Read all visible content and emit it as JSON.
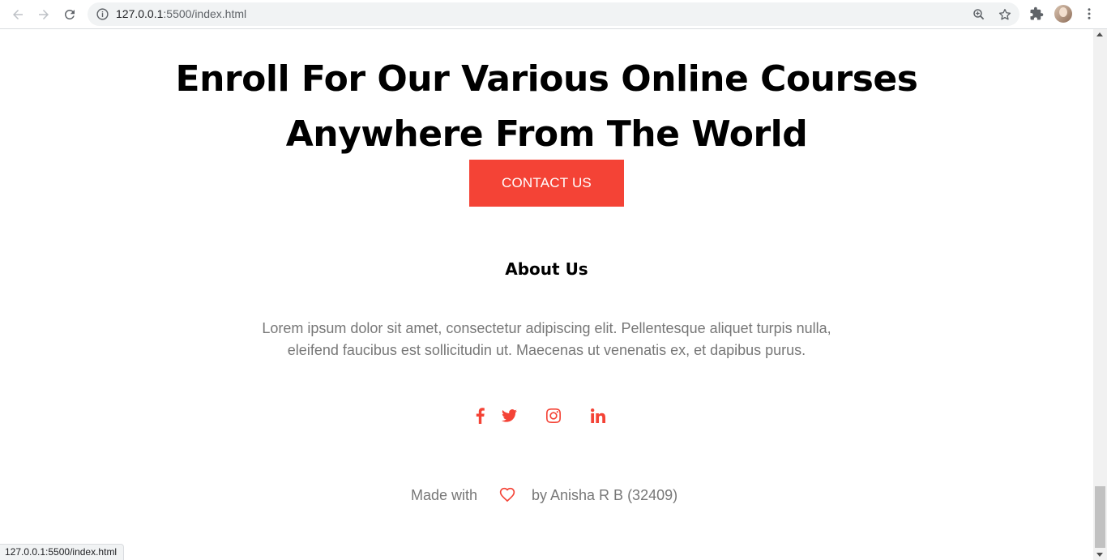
{
  "browser": {
    "url_host": "127.0.0.1",
    "url_rest": ":5500/index.html",
    "status_url": "127.0.0.1:5500/index.html"
  },
  "hero": {
    "title_line1": "Enroll For Our Various Online Courses",
    "title_line2": "Anywhere From The World",
    "cta_label": "CONTACT US"
  },
  "about": {
    "title": "About Us",
    "text_line1": "Lorem ipsum dolor sit amet, consectetur adipiscing elit. Pellentesque aliquet turpis nulla,",
    "text_line2": "eleifend faucibus est sollicitudin ut. Maecenas ut venenatis ex, et dapibus purus."
  },
  "social": [
    "facebook-icon",
    "twitter-icon",
    "instagram-icon",
    "linkedin-icon"
  ],
  "footer": {
    "made_with": "Made with",
    "by": "by Anisha R B (32409)"
  },
  "colors": {
    "accent": "#f44336",
    "muted_text": "#777777"
  }
}
